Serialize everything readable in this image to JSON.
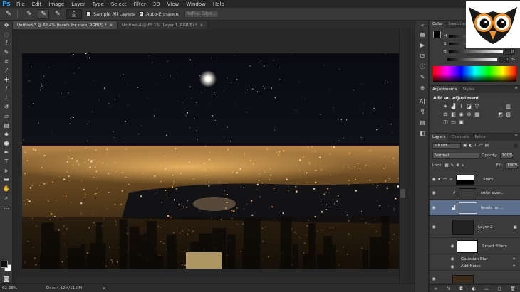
{
  "app": {
    "logo": "Ps"
  },
  "menu": [
    "File",
    "Edit",
    "Image",
    "Layer",
    "Type",
    "Select",
    "Filter",
    "3D",
    "View",
    "Window",
    "Help"
  ],
  "options": {
    "brush_size": "30",
    "sample_all_layers": "Sample All Layers",
    "auto_enhance": "Auto-Enhance",
    "refine_edge": "Refine Edge..."
  },
  "tabs": [
    {
      "label": "Untitled-3 @ 62.4% (levels for stars, RGB/8) *",
      "close": "×"
    },
    {
      "label": "Untitled-4 @ 65.1% (Layer 1, RGB/8) *",
      "close": "×"
    }
  ],
  "status": {
    "zoom": "62.38%",
    "doc": "Doc: 4.12M/11.0M"
  },
  "color_panel": {
    "tabs": [
      "Color",
      "Swatches"
    ],
    "sliders": [
      {
        "label": "H",
        "value": ""
      },
      {
        "label": "S",
        "value": ""
      },
      {
        "label": "B",
        "value": "0"
      }
    ],
    "percent": "%",
    "extra_value": "0"
  },
  "adjustments_panel": {
    "tabs": [
      "Adjustments",
      "Styles"
    ],
    "title": "Add an adjustment"
  },
  "layers_panel": {
    "tabs": [
      "Layers",
      "Channels",
      "Paths"
    ],
    "kind": "Kind",
    "blend_mode": "Normal",
    "opacity_label": "Opacity:",
    "opacity": "100%",
    "lock_label": "Lock:",
    "fill_label": "Fill:",
    "fill": "100%",
    "layers": [
      {
        "name": "Stars"
      },
      {
        "name": "color over..."
      },
      {
        "name": "levels for ..."
      },
      {
        "name": "Layer 2"
      },
      {
        "name": "Smart Filters"
      },
      {
        "name": "Gaussian Blur"
      },
      {
        "name": "Add Noise"
      }
    ],
    "bottom_icons": [
      "link-icon",
      "fx-icon",
      "mask-icon",
      "adjustment-icon",
      "folder-icon",
      "new-layer-icon",
      "trash-icon"
    ]
  },
  "colors": {
    "accent": "#31a8ff",
    "panel_bg": "#3b3b3b",
    "selected_layer": "#5b6e8b",
    "owl_orange": "#f29123"
  }
}
